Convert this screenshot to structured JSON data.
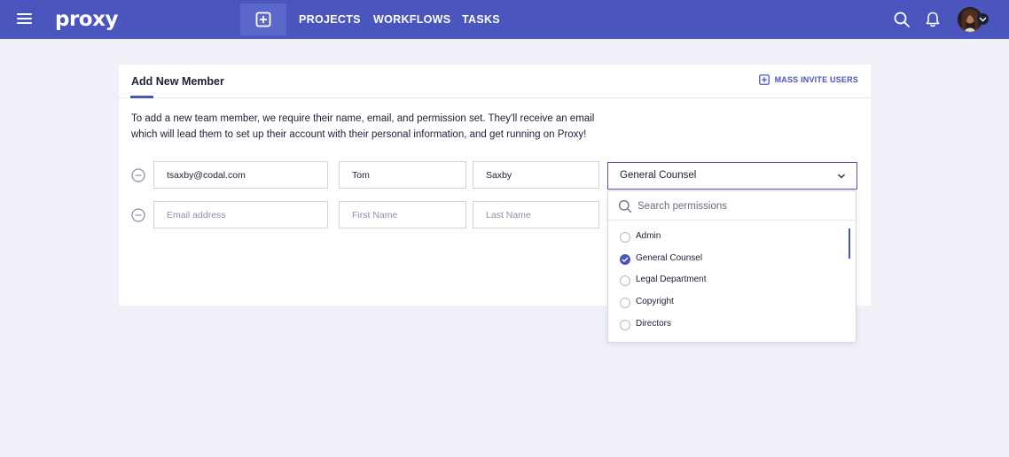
{
  "app": {
    "logo": "proxy"
  },
  "nav": {
    "links": [
      "PROJECTS",
      "WORKFLOWS",
      "TASKS"
    ],
    "icons": [
      "menu-icon",
      "add-square-icon",
      "search-icon",
      "bell-icon",
      "avatar",
      "chevron-down-icon"
    ]
  },
  "colors": {
    "brand": "#4a55bd",
    "page_bg": "#eff0f8",
    "text": "#1d1f36"
  },
  "card": {
    "title": "Add New Member",
    "mass_invite_label": "MASS INVITE USERS",
    "intro_line1": "To add a new team member, we require their name, email, and permission set. They'll receive an email",
    "intro_line2": "which will lead them to set up their account with their personal information, and get running on Proxy!"
  },
  "members": [
    {
      "email": "tsaxby@codal.com",
      "first_name": "Tom",
      "last_name": "Saxby",
      "permission": "General Counsel"
    },
    {
      "email": "",
      "first_name": "",
      "last_name": "",
      "permission": ""
    }
  ],
  "placeholders": {
    "email": "Email address",
    "first_name": "First Name",
    "last_name": "Last Name"
  },
  "permissions_dropdown": {
    "search_placeholder": "Search permissions",
    "options": [
      {
        "label": "Admin",
        "selected": false
      },
      {
        "label": "General Counsel",
        "selected": true
      },
      {
        "label": "Legal Department",
        "selected": false
      },
      {
        "label": "Copyright",
        "selected": false
      },
      {
        "label": "Directors",
        "selected": false
      }
    ]
  }
}
